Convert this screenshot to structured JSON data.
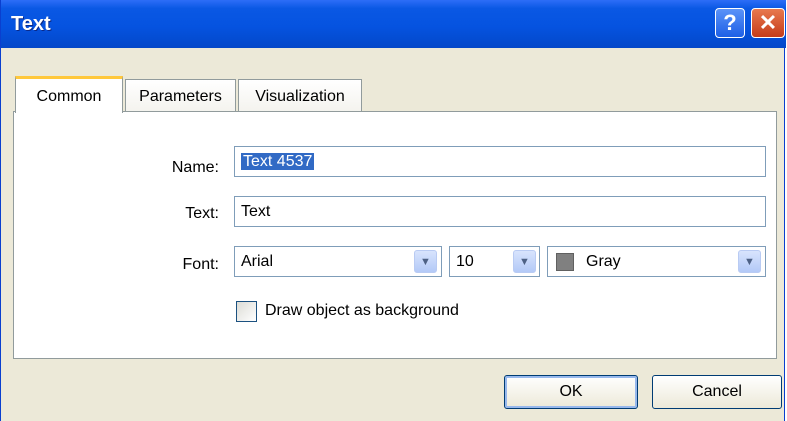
{
  "window": {
    "title": "Text"
  },
  "titlebar": {
    "help_glyph": "?",
    "close_glyph": "✕"
  },
  "tabs": [
    {
      "label": "Common",
      "active": true
    },
    {
      "label": "Parameters",
      "active": false
    },
    {
      "label": "Visualization",
      "active": false
    }
  ],
  "form": {
    "name_label": "Name:",
    "name_value": "Text 4537",
    "text_label": "Text:",
    "text_value": "Text",
    "font_label": "Font:",
    "font_family": "Arial",
    "font_size": "10",
    "font_color": "Gray",
    "font_color_hex": "#808080",
    "background_checkbox_label": "Draw object as background",
    "background_checked": false
  },
  "dropdown_glyph": "▼",
  "buttons": {
    "ok": "OK",
    "cancel": "Cancel"
  },
  "colors": {
    "titlebar": "#0553e0",
    "dialog_bg": "#ece9d8",
    "selection": "#316ac5",
    "active_tab_accent": "#ffc83c"
  }
}
